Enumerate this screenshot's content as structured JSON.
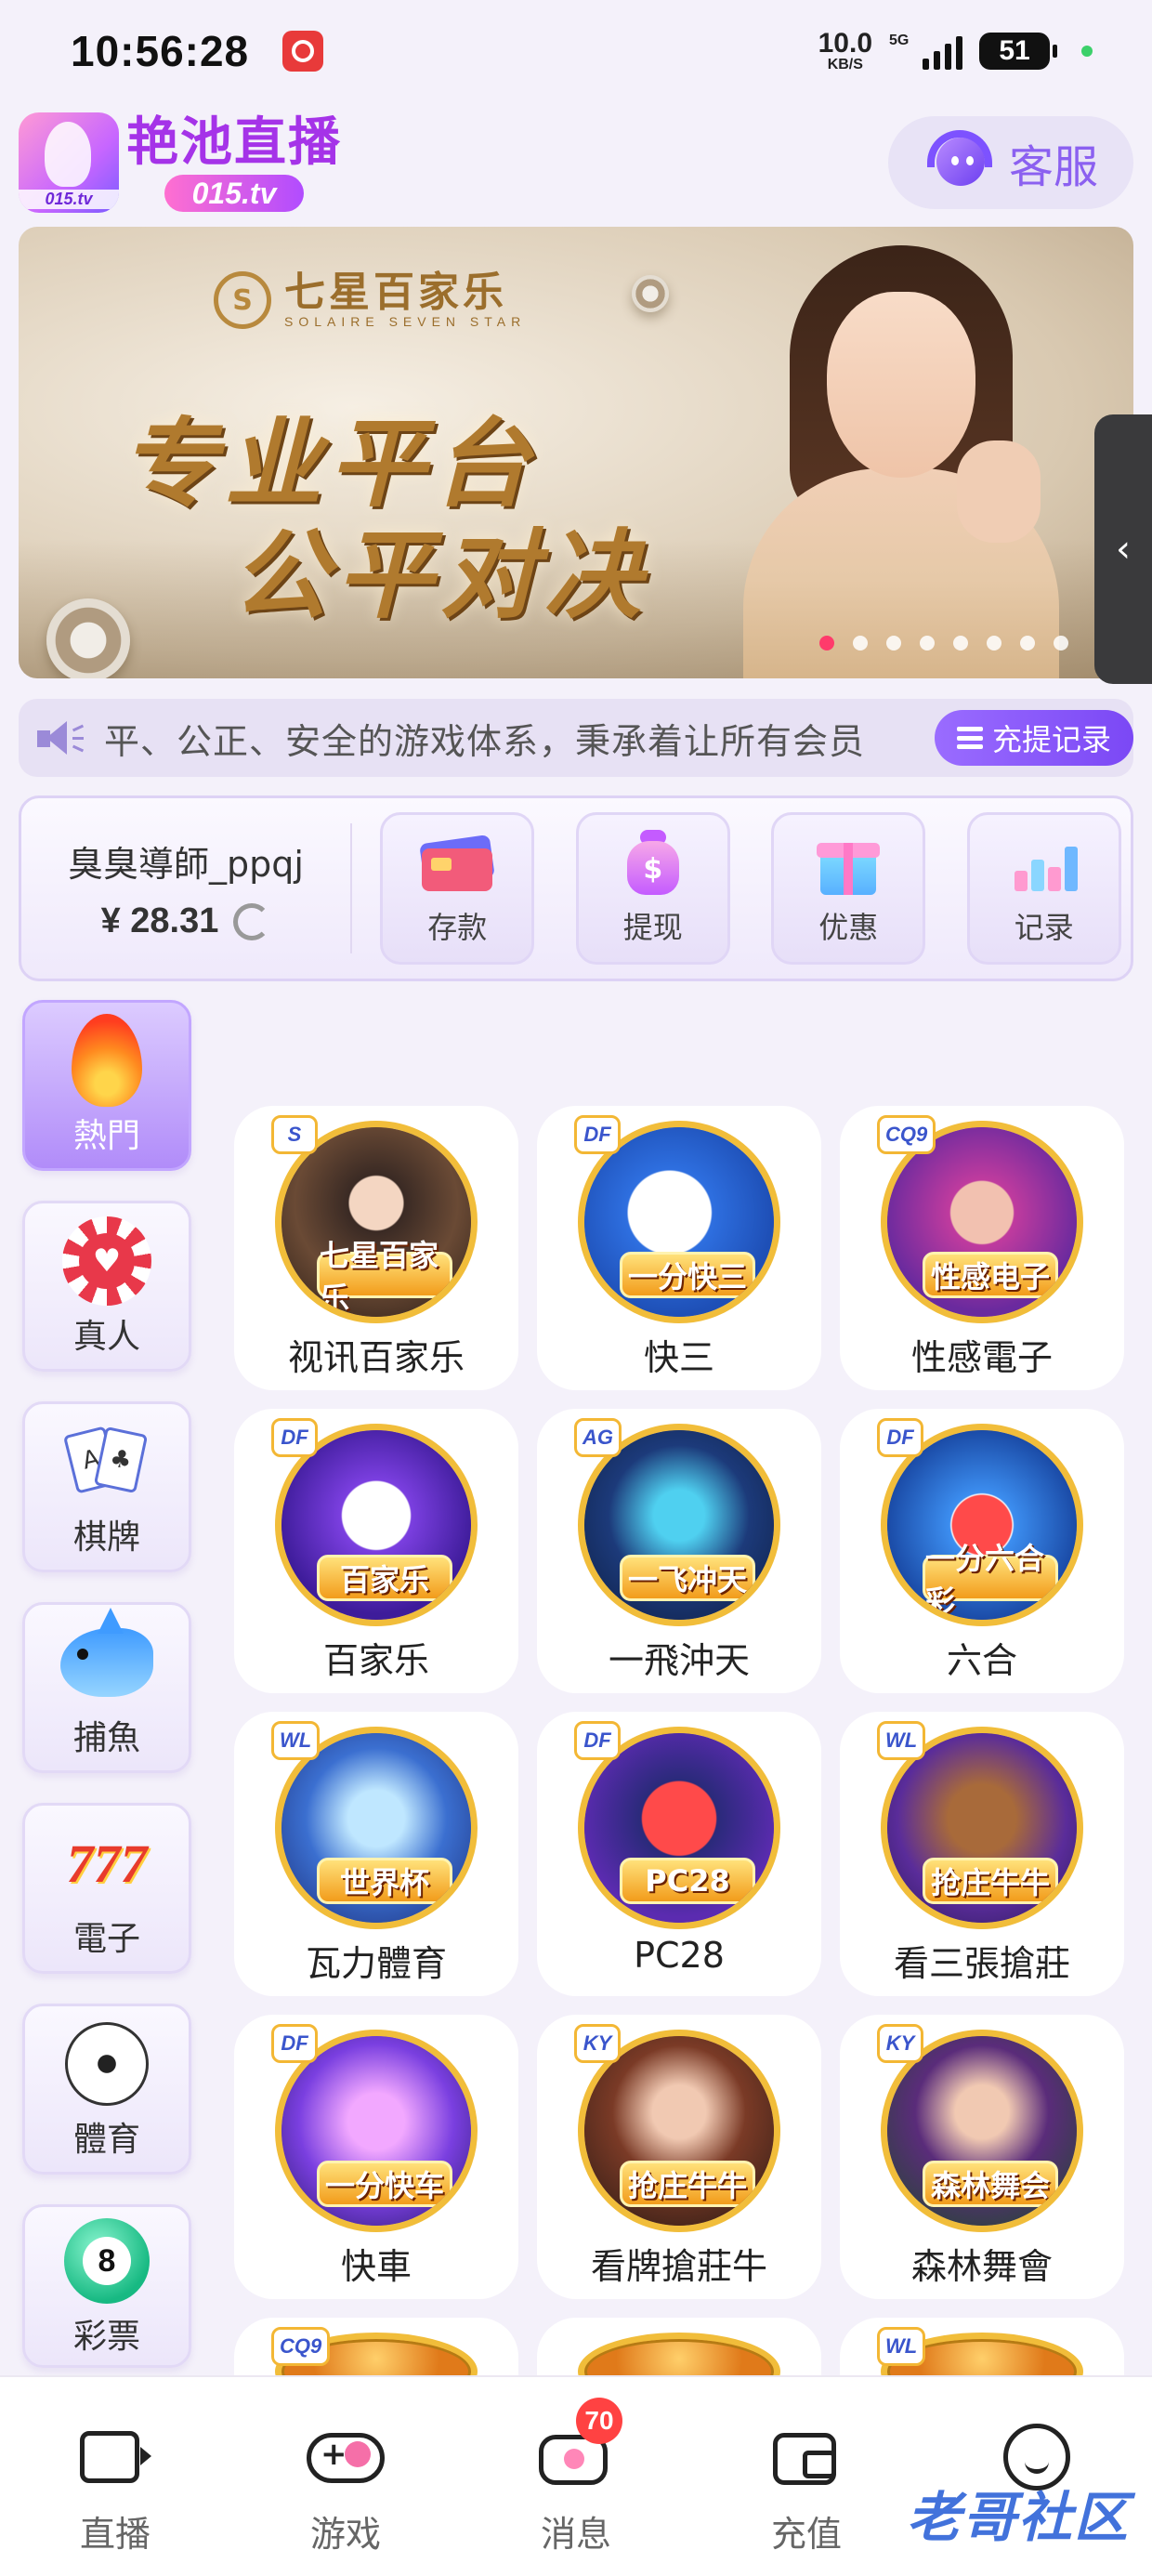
{
  "status_bar": {
    "time": "10:56:28",
    "net_speed_value": "10.0",
    "net_speed_unit": "KB/S",
    "signal_label": "5G",
    "battery": "51"
  },
  "header": {
    "logo_title": "艳池直播",
    "logo_domain": "015.tv",
    "logo_mini": "015.tv",
    "service_label": "客服"
  },
  "banner": {
    "brand_name": "七星百家乐",
    "brand_sub": "SOLAIRE SEVEN STAR",
    "slogan_line1": "专业平台",
    "slogan_line2": "公平对决",
    "dots_total": 8,
    "active_dot": 1
  },
  "marquee": {
    "text": "平、公正、安全的游戏体系，秉承着让所有会员",
    "records_button": "充提记录"
  },
  "wallet": {
    "username": "臭臭導師_ppqj",
    "balance": "¥ 28.31",
    "actions": [
      {
        "label": "存款",
        "icon": "bank-card-icon"
      },
      {
        "label": "提现",
        "icon": "money-bag-icon"
      },
      {
        "label": "优惠",
        "icon": "gift-box-icon"
      },
      {
        "label": "记录",
        "icon": "bar-chart-icon"
      }
    ]
  },
  "categories": [
    {
      "label": "熱門",
      "icon": "flame-icon",
      "active": true
    },
    {
      "label": "真人",
      "icon": "poker-chip-icon"
    },
    {
      "label": "棋牌",
      "icon": "playing-cards-icon"
    },
    {
      "label": "捕魚",
      "icon": "shark-icon"
    },
    {
      "label": "電子",
      "icon": "slot-777-icon"
    },
    {
      "label": "體育",
      "icon": "soccer-ball-icon"
    },
    {
      "label": "彩票",
      "icon": "lottery-ball-icon"
    }
  ],
  "games": [
    {
      "name": "视讯百家乐",
      "badge": "七星百家乐",
      "provider": "S"
    },
    {
      "name": "快三",
      "badge": "一分快三",
      "provider": "DF"
    },
    {
      "name": "性感電子",
      "badge": "性感电子",
      "provider": "CQ9"
    },
    {
      "name": "百家乐",
      "badge": "百家乐",
      "provider": "DF"
    },
    {
      "name": "一飛沖天",
      "badge": "一飞冲天",
      "provider": "AG"
    },
    {
      "name": "六合",
      "badge": "一分六合彩",
      "provider": "DF"
    },
    {
      "name": "瓦力體育",
      "badge": "世界杯",
      "provider": "WL"
    },
    {
      "name": "PC28",
      "badge": "PC28",
      "provider": "DF"
    },
    {
      "name": "看三張搶莊",
      "badge": "抢庄牛牛",
      "provider": "WL"
    },
    {
      "name": "快車",
      "badge": "一分快车",
      "provider": "DF"
    },
    {
      "name": "看牌搶莊牛",
      "badge": "抢庄牛牛",
      "provider": "KY"
    },
    {
      "name": "森林舞會",
      "badge": "森林舞会",
      "provider": "KY"
    }
  ],
  "partial_games": [
    {
      "provider": "CQ9"
    },
    {
      "provider": ""
    },
    {
      "provider": "WL"
    }
  ],
  "bottom_nav": [
    {
      "label": "直播",
      "icon": "tv-icon"
    },
    {
      "label": "游戏",
      "icon": "gamepad-icon"
    },
    {
      "label": "消息",
      "icon": "message-icon",
      "badge": "70"
    },
    {
      "label": "充值",
      "icon": "wallet-icon"
    },
    {
      "label": "",
      "icon": "smile-icon"
    }
  ],
  "watermark": "老哥社区",
  "colors": {
    "accent": "#8b60f0",
    "primary_purple": "#7b48f5",
    "badge_red": "#ff4242",
    "page_bg": "#f4f1fa"
  }
}
